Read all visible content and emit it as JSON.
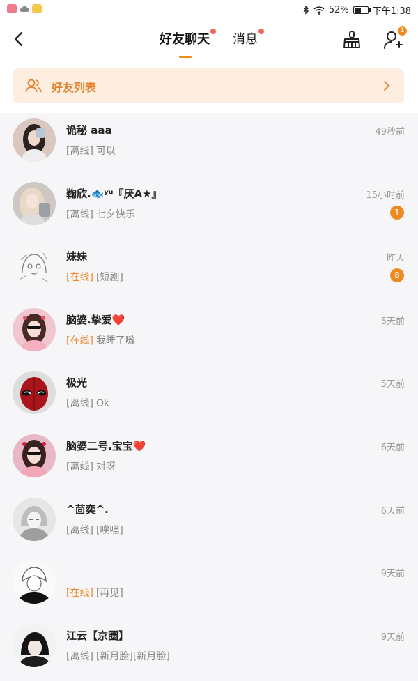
{
  "status_bar": {
    "battery": "52%",
    "time": "下午1:38"
  },
  "header": {
    "tabs": [
      {
        "label": "好友聊天",
        "active": true,
        "dot": true
      },
      {
        "label": "消息",
        "active": false,
        "dot": true
      }
    ],
    "add_friend_badge": "1"
  },
  "friends_banner": {
    "label": "好友列表"
  },
  "chats": [
    {
      "name": "诡秘 aaa",
      "status": "[离线]",
      "online": false,
      "message": "可以",
      "time": "49秒前",
      "unread": null
    },
    {
      "name": "鞠欣.🐟ʸᵘ『厌A★』",
      "status": "[离线]",
      "online": false,
      "message": "七夕快乐",
      "time": "15小时前",
      "unread": "1"
    },
    {
      "name": "妹妹",
      "status": "[在线]",
      "online": true,
      "message": "[短剧]",
      "time": "昨天",
      "unread": "8"
    },
    {
      "name": "脑婆.挚爱❤️",
      "status": "[在线]",
      "online": true,
      "message": "我睡了嗷",
      "time": "5天前",
      "unread": null
    },
    {
      "name": "极光",
      "status": "[离线]",
      "online": false,
      "message": "Ok",
      "time": "5天前",
      "unread": null
    },
    {
      "name": "脑婆二号.宝宝❤️",
      "status": "[离线]",
      "online": false,
      "message": "对呀",
      "time": "6天前",
      "unread": null
    },
    {
      "name": "^茴奕^.",
      "status": "[离线]",
      "online": false,
      "message": "[唉嘿]",
      "time": "6天前",
      "unread": null
    },
    {
      "name": "",
      "status": "[在线]",
      "online": true,
      "message": "[再见]",
      "time": "9天前",
      "unread": null
    },
    {
      "name": "江云【京圈】",
      "status": "[离线]",
      "online": false,
      "message": "[新月脸][新月脸]",
      "time": "9天前",
      "unread": null
    }
  ],
  "colors": {
    "accent": "#f08a1d",
    "online": "#ef8a2c",
    "banner_bg": "#fdeee0",
    "red_dot": "#f2665a"
  }
}
